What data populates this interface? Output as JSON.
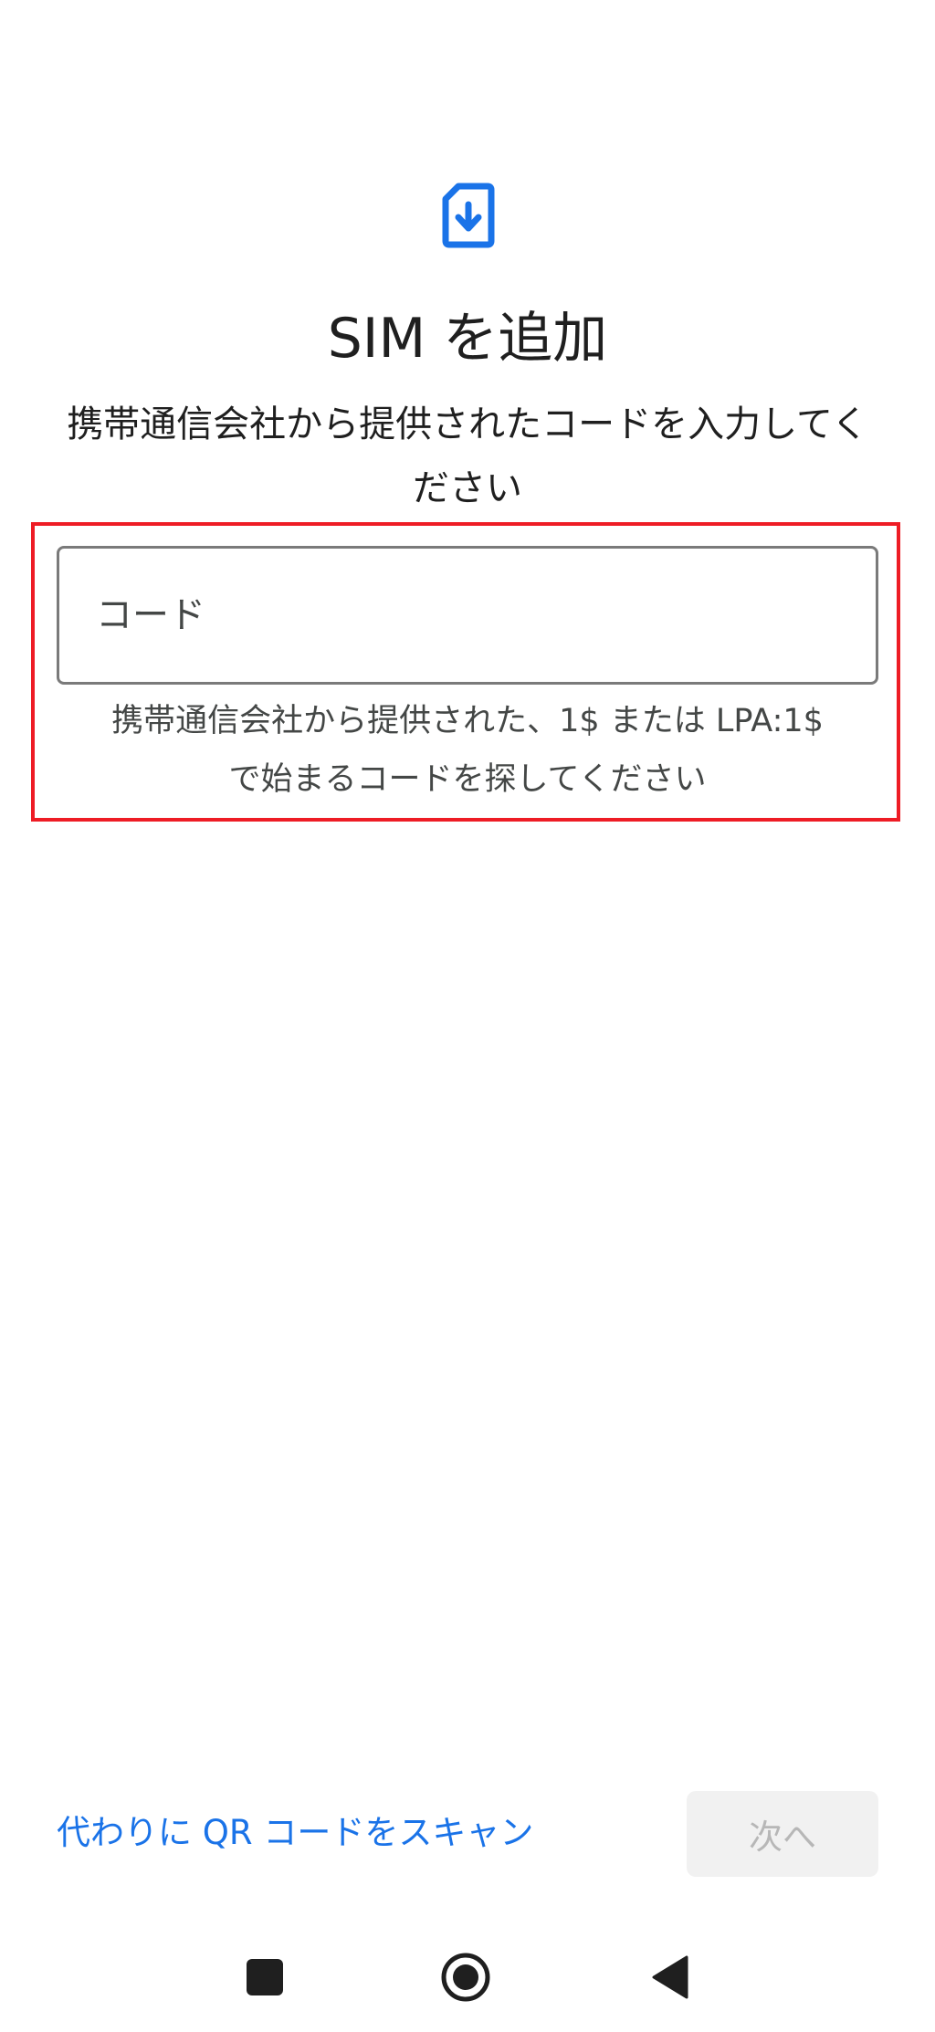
{
  "header": {
    "icon": "sim-download-icon",
    "title": "SIM を追加",
    "subtitle": "携帯通信会社から提供されたコードを入力してください"
  },
  "code_field": {
    "value": "",
    "placeholder": "コード",
    "helper_text_line1": "携帯通信会社から提供された、1$ または LPA:1$",
    "helper_text_line2": "で始まるコードを探してください"
  },
  "footer": {
    "qr_link_label": "代わりに QR コードをスキャン",
    "next_button_label": "次へ",
    "next_button_enabled": false
  },
  "nav_bar": {
    "recents_icon": "square-recents-icon",
    "home_icon": "circle-home-icon",
    "back_icon": "triangle-back-icon"
  },
  "colors": {
    "accent": "#1a73e8",
    "highlight": "#ee1c25",
    "field_border": "#7a7a7a",
    "disabled_button_bg": "#f1f1f1",
    "disabled_button_text": "#b7b7b7"
  }
}
